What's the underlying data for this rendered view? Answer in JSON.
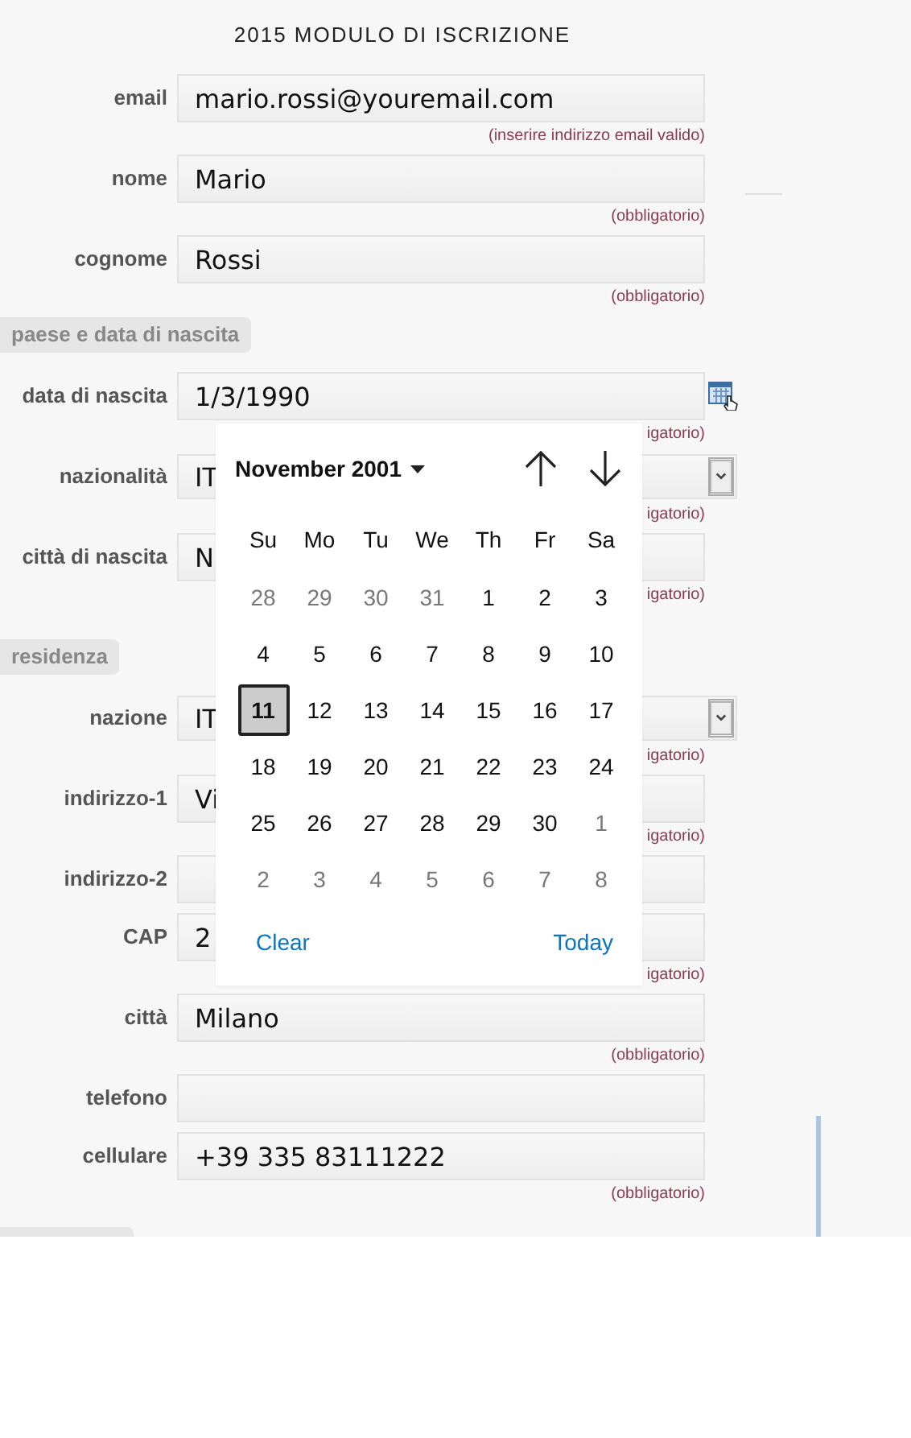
{
  "title": "2015 MODULO DI ISCRIZIONE",
  "sections": [
    {
      "rows": [
        {
          "label": "email",
          "kind": "text",
          "value": "mario.rossi@youremail.com",
          "hint": "(inserire indirizzo email valido)"
        },
        {
          "label": "nome",
          "kind": "text",
          "value": "Mario",
          "hint": "(obbligatorio)"
        },
        {
          "label": "cognome",
          "kind": "text",
          "value": "Rossi",
          "hint": "(obbligatorio)"
        }
      ]
    },
    {
      "heading": "paese e data di nascita",
      "rows": [
        {
          "label": "data di nascita",
          "kind": "date",
          "value": "1/3/1990",
          "hint": "igatorio)"
        },
        {
          "label": "nazionalità",
          "kind": "select",
          "value": "IT",
          "hint": "igatorio)"
        },
        {
          "label": "città di nascita",
          "kind": "text",
          "value": "N",
          "hint": "igatorio)"
        }
      ]
    },
    {
      "heading": "residenza",
      "rows": [
        {
          "label": "nazione",
          "kind": "select",
          "value": "IT",
          "hint": "igatorio)"
        },
        {
          "label": "indirizzo-1",
          "kind": "text",
          "value": "Vi",
          "hint": "igatorio)"
        },
        {
          "label": "indirizzo-2",
          "kind": "text"
        },
        {
          "label": "CAP",
          "kind": "text",
          "value": "2",
          "hint": "igatorio)"
        },
        {
          "label": "città",
          "kind": "text",
          "value": "Milano",
          "hint": "(obbligatorio)"
        },
        {
          "label": "telefono",
          "kind": "text"
        },
        {
          "label": "cellulare",
          "kind": "text",
          "value": "+39 335 83111222",
          "hint": "(obbligatorio)"
        }
      ]
    }
  ],
  "calendar": {
    "month": "November 2001",
    "weekdays": [
      "Su",
      "Mo",
      "Tu",
      "We",
      "Th",
      "Fr",
      "Sa"
    ],
    "weeks": [
      [
        {
          "day": "28",
          "other_month": true,
          "selected": false
        },
        {
          "day": "29",
          "other_month": true,
          "selected": false
        },
        {
          "day": "30",
          "other_month": true,
          "selected": false
        },
        {
          "day": "31",
          "other_month": true,
          "selected": false
        },
        {
          "day": "1",
          "other_month": false,
          "selected": false
        },
        {
          "day": "2",
          "other_month": false,
          "selected": false
        },
        {
          "day": "3",
          "other_month": false,
          "selected": false
        }
      ],
      [
        {
          "day": "4",
          "other_month": false,
          "selected": false
        },
        {
          "day": "5",
          "other_month": false,
          "selected": false
        },
        {
          "day": "6",
          "other_month": false,
          "selected": false
        },
        {
          "day": "7",
          "other_month": false,
          "selected": false
        },
        {
          "day": "8",
          "other_month": false,
          "selected": false
        },
        {
          "day": "9",
          "other_month": false,
          "selected": false
        },
        {
          "day": "10",
          "other_month": false,
          "selected": false
        }
      ],
      [
        {
          "day": "11",
          "other_month": false,
          "selected": true
        },
        {
          "day": "12",
          "other_month": false,
          "selected": false
        },
        {
          "day": "13",
          "other_month": false,
          "selected": false
        },
        {
          "day": "14",
          "other_month": false,
          "selected": false
        },
        {
          "day": "15",
          "other_month": false,
          "selected": false
        },
        {
          "day": "16",
          "other_month": false,
          "selected": false
        },
        {
          "day": "17",
          "other_month": false,
          "selected": false
        }
      ],
      [
        {
          "day": "18",
          "other_month": false,
          "selected": false
        },
        {
          "day": "19",
          "other_month": false,
          "selected": false
        },
        {
          "day": "20",
          "other_month": false,
          "selected": false
        },
        {
          "day": "21",
          "other_month": false,
          "selected": false
        },
        {
          "day": "22",
          "other_month": false,
          "selected": false
        },
        {
          "day": "23",
          "other_month": false,
          "selected": false
        },
        {
          "day": "24",
          "other_month": false,
          "selected": false
        }
      ],
      [
        {
          "day": "25",
          "other_month": false,
          "selected": false
        },
        {
          "day": "26",
          "other_month": false,
          "selected": false
        },
        {
          "day": "27",
          "other_month": false,
          "selected": false
        },
        {
          "day": "28",
          "other_month": false,
          "selected": false
        },
        {
          "day": "29",
          "other_month": false,
          "selected": false
        },
        {
          "day": "30",
          "other_month": false,
          "selected": false
        },
        {
          "day": "1",
          "other_month": true,
          "selected": false
        }
      ],
      [
        {
          "day": "2",
          "other_month": true,
          "selected": false
        },
        {
          "day": "3",
          "other_month": true,
          "selected": false
        },
        {
          "day": "4",
          "other_month": true,
          "selected": false
        },
        {
          "day": "5",
          "other_month": true,
          "selected": false
        },
        {
          "day": "6",
          "other_month": true,
          "selected": false
        },
        {
          "day": "7",
          "other_month": true,
          "selected": false
        },
        {
          "day": "8",
          "other_month": true,
          "selected": false
        }
      ]
    ],
    "clear": "Clear",
    "today": "Today"
  }
}
